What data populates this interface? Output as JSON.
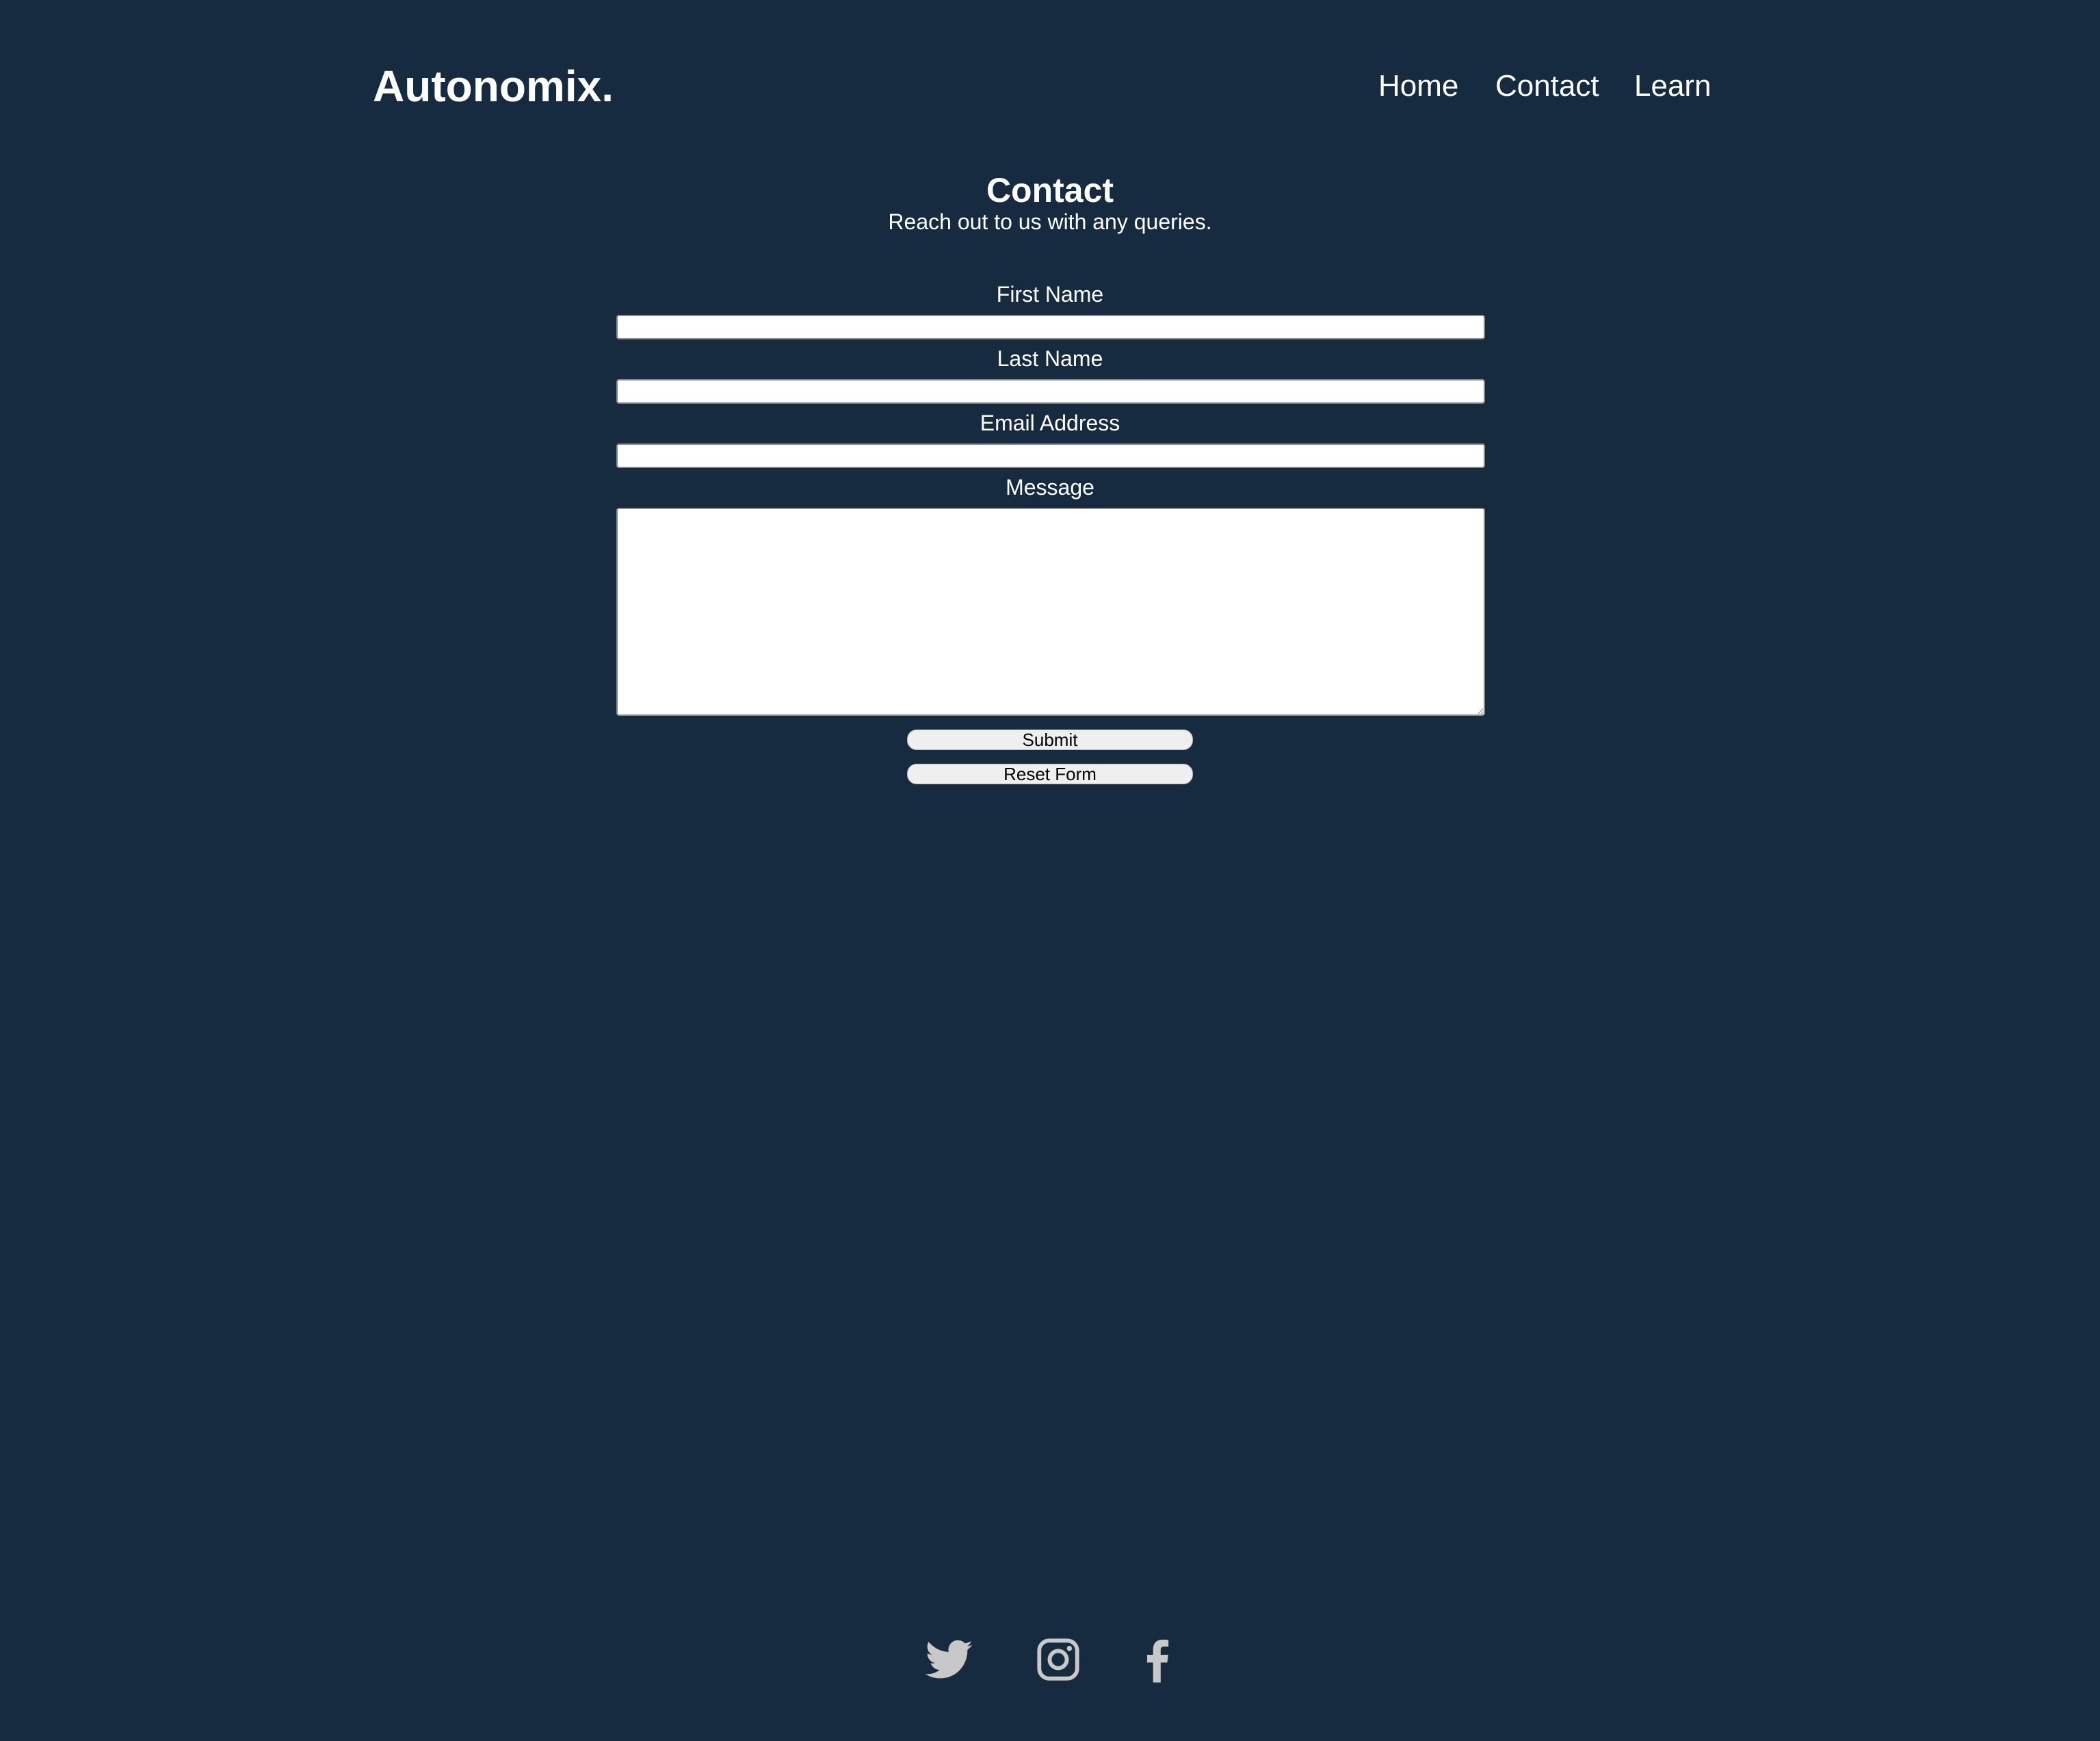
{
  "header": {
    "logo": "Autonomix.",
    "nav": [
      {
        "label": "Home"
      },
      {
        "label": "Contact"
      },
      {
        "label": "Learn"
      }
    ]
  },
  "main": {
    "title": "Contact",
    "subtitle": "Reach out to us with any queries.",
    "form": {
      "first_name": {
        "label": "First Name",
        "value": ""
      },
      "last_name": {
        "label": "Last Name",
        "value": ""
      },
      "email": {
        "label": "Email Address",
        "value": ""
      },
      "message": {
        "label": "Message",
        "value": ""
      },
      "submit_label": "Submit",
      "reset_label": "Reset Form"
    }
  },
  "footer": {
    "social_icons": [
      "twitter-icon",
      "instagram-icon",
      "facebook-icon"
    ],
    "icon_color": "#c8c8c8"
  },
  "colors": {
    "background": "#172b40",
    "text": "#ffffff",
    "button_background": "#efefef"
  }
}
